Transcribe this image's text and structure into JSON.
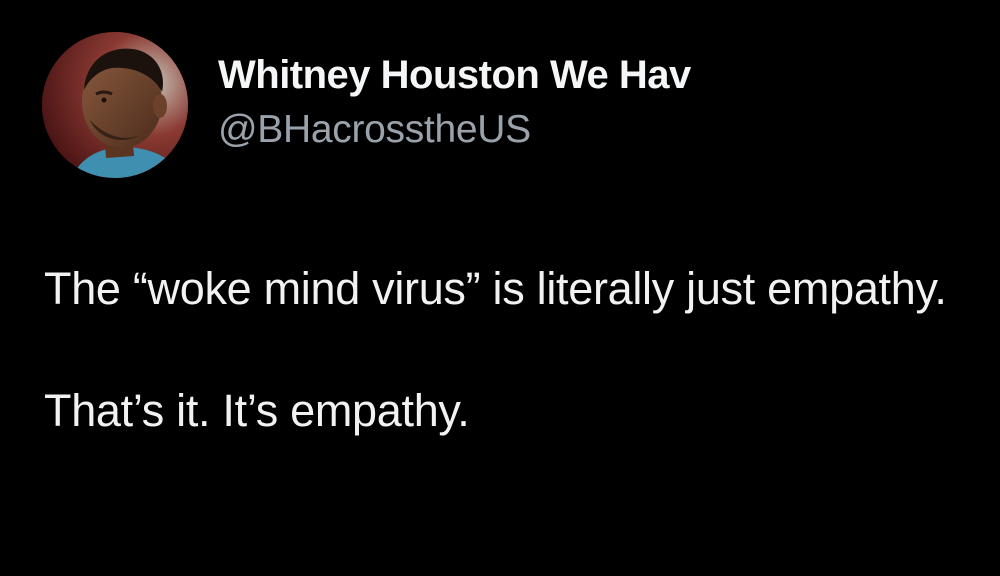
{
  "tweet": {
    "author": {
      "display_name": "Whitney Houston We Hav",
      "handle": "@BHacrosstheUS",
      "avatar_icon": "profile-photo-man-icon"
    },
    "text": {
      "paragraph_1": "The “woke mind virus” is literally just empathy.",
      "paragraph_2": "That’s it. It’s empathy."
    }
  },
  "colors": {
    "background": "#000000",
    "name_text": "#f4f6f7",
    "handle_text": "#9aa3ab",
    "body_text": "#f2f2f2"
  }
}
